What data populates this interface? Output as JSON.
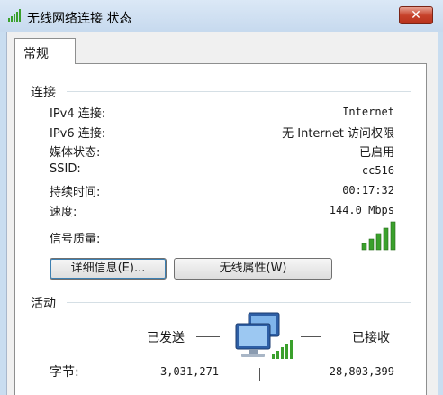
{
  "window": {
    "title": "无线网络连接 状态",
    "close_label": "✕"
  },
  "tabs": [
    {
      "label": "常规"
    }
  ],
  "connection": {
    "heading": "连接",
    "rows": [
      {
        "label": "IPv4 连接:",
        "value": "Internet"
      },
      {
        "label": "IPv6 连接:",
        "value": "无 Internet 访问权限"
      },
      {
        "label": "媒体状态:",
        "value": "已启用"
      },
      {
        "label": "SSID:",
        "value": "cc516"
      },
      {
        "label": "持续时间:",
        "value": "00:17:32"
      },
      {
        "label": "速度:",
        "value": "144.0 Mbps"
      }
    ],
    "signal_label": "信号质量:",
    "signal_bars": 5,
    "signal_icon": "signal-bars-icon"
  },
  "buttons": {
    "details": "详细信息(E)...",
    "wireless_properties": "无线属性(W)"
  },
  "activity": {
    "heading": "活动",
    "sent_label": "已发送",
    "received_label": "已接收",
    "bytes_label": "字节:",
    "bytes_sent": "3,031,271",
    "bytes_received": "28,803,399",
    "icon": "network-computers-icon"
  },
  "colors": {
    "signal": "#3aa02c",
    "close": "#c7422b",
    "titlebar": "#c6d9ee"
  }
}
